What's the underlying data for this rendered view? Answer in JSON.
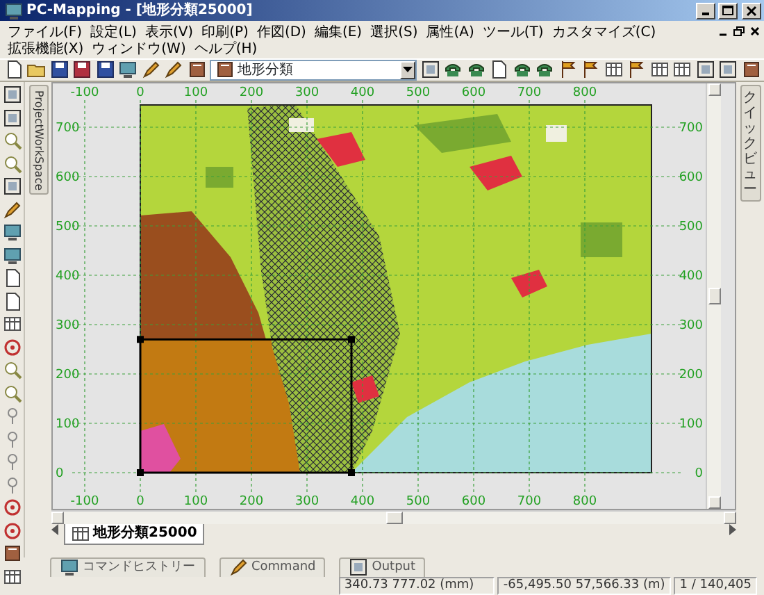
{
  "window": {
    "title": "PC-Mapping - [地形分類25000]"
  },
  "menu": [
    "ファイル(F)",
    "設定(L)",
    "表示(V)",
    "印刷(P)",
    "作図(D)",
    "編集(E)",
    "選択(S)",
    "属性(A)",
    "ツール(T)",
    "カスタマイズ(C)",
    "拡張機能(X)",
    "ウィンドウ(W)",
    "ヘルプ(H)"
  ],
  "layer_combo": {
    "value": "地形分類"
  },
  "workspace_tab": {
    "label": "ProjectWorkSpace"
  },
  "quickview_tab": {
    "label": "クイックビュー"
  },
  "ruler": {
    "top_labels": [
      "-100",
      "0",
      "100",
      "200",
      "300",
      "400",
      "500",
      "600",
      "700",
      "800"
    ],
    "left_labels": [
      "700",
      "600",
      "500",
      "400",
      "300",
      "200",
      "100",
      "0"
    ],
    "right_labels": [
      "700",
      "600",
      "500",
      "400",
      "300",
      "200",
      "100",
      "0"
    ],
    "bottom_labels": [
      "-100",
      "0",
      "100",
      "200",
      "300",
      "400",
      "500",
      "600",
      "700",
      "800"
    ]
  },
  "document_tabs": [
    {
      "label": "地形分類25000",
      "selected": true
    }
  ],
  "panel_tabs": [
    {
      "label": "コマンドヒストリー",
      "selected": false
    },
    {
      "label": "Command",
      "selected": false
    },
    {
      "label": "Output",
      "selected": false
    }
  ],
  "status_bar": [
    "340.73 777.02 (mm)",
    "-65,495.50 57,566.33 (m)",
    "1 / 140,405"
  ]
}
